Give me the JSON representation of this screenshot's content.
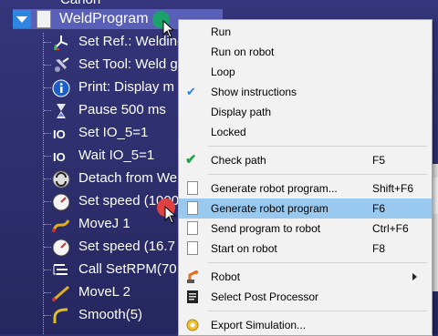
{
  "tree": {
    "partial_top": "Canon",
    "program_name": "WeldProgram",
    "items": [
      {
        "label": "Set Ref.: Weldinc",
        "icon": "reference-frame-icon"
      },
      {
        "label": "Set Tool: Weld g",
        "icon": "tool-icon"
      },
      {
        "label": "Print: Display m",
        "icon": "info-icon"
      },
      {
        "label": "Pause 500 ms",
        "icon": "hourglass-icon"
      },
      {
        "label": "Set IO_5=1",
        "icon": "io-icon"
      },
      {
        "label": "Wait IO_5=1",
        "icon": "io-icon"
      },
      {
        "label": "Detach from We",
        "icon": "detach-icon"
      },
      {
        "label": "Set speed (1000",
        "icon": "speedometer-icon"
      },
      {
        "label": "MoveJ 1",
        "icon": "movej-icon"
      },
      {
        "label": "Set speed (16.7",
        "icon": "speedometer-icon"
      },
      {
        "label": "Call SetRPM(70",
        "icon": "call-program-icon"
      },
      {
        "label": "MoveL 2",
        "icon": "movel-icon"
      },
      {
        "label": "Smooth(5)",
        "icon": "smooth-icon"
      }
    ]
  },
  "menu": {
    "items": [
      {
        "label": "Run"
      },
      {
        "label": "Run on robot"
      },
      {
        "label": "Loop"
      },
      {
        "label": "Show instructions",
        "checked": true
      },
      {
        "label": "Display path"
      },
      {
        "label": "Locked"
      },
      {
        "label": "Check path",
        "shortcut": "F5"
      },
      {
        "label": "Generate robot program...",
        "shortcut": "Shift+F6"
      },
      {
        "label": "Generate robot program",
        "shortcut": "F6"
      },
      {
        "label": "Send program to robot",
        "shortcut": "Ctrl+F6"
      },
      {
        "label": "Start on robot",
        "shortcut": "F8"
      },
      {
        "label": "Robot"
      },
      {
        "label": "Select Post Processor"
      },
      {
        "label": "Export Simulation..."
      }
    ]
  },
  "colors": {
    "background": "#2f3070",
    "selection": "#5a5fb8",
    "menu_highlight": "#99c9ef",
    "check_blue": "#2c7fd8",
    "check_green": "#21a045"
  }
}
